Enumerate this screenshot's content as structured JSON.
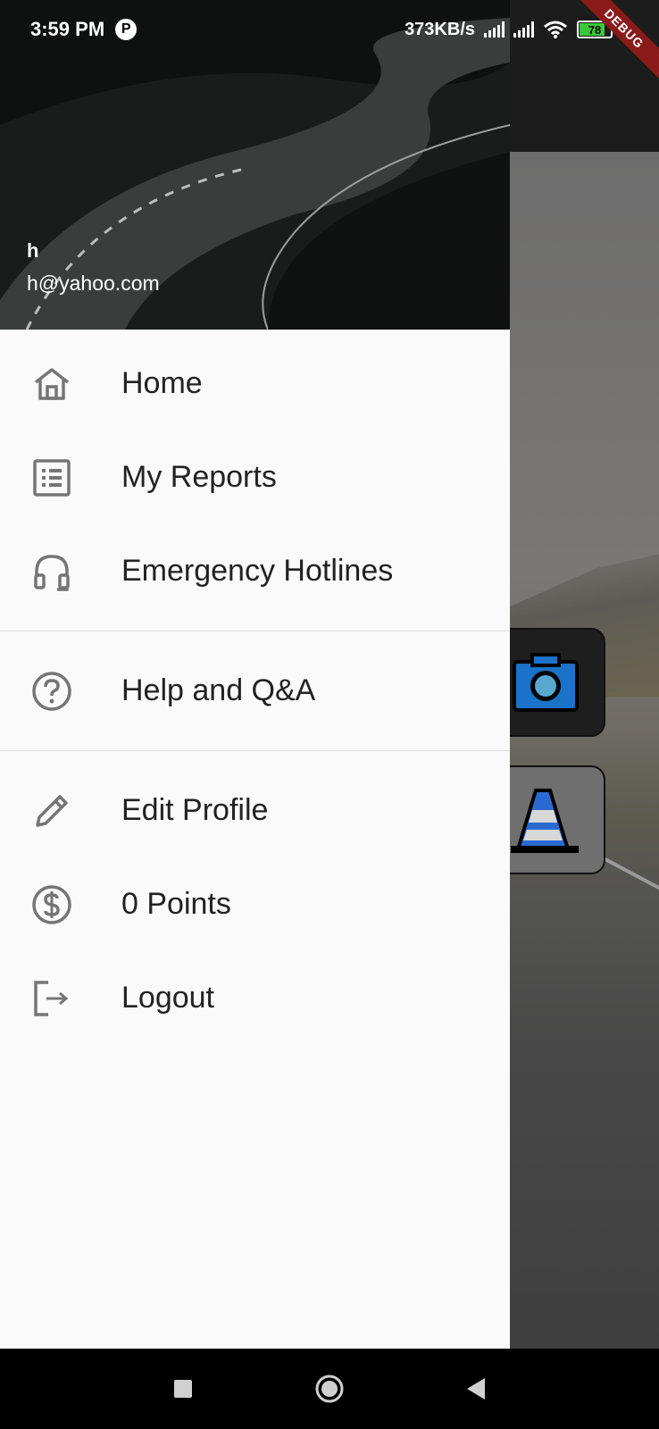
{
  "status_bar": {
    "time": "3:59 PM",
    "net_speed": "373KB/s",
    "battery_level": "78",
    "debug_label": "DEBUG"
  },
  "drawer": {
    "user": {
      "name": "h",
      "email": "h@yahoo.com"
    },
    "menu_items": [
      {
        "label": "Home",
        "icon": "home-icon"
      },
      {
        "label": "My Reports",
        "icon": "list-icon"
      },
      {
        "label": "Emergency Hotlines",
        "icon": "headset-icon"
      },
      {
        "label": "Help and Q&A",
        "icon": "help-circle-icon"
      },
      {
        "label": "Edit Profile",
        "icon": "pencil-icon"
      },
      {
        "label": "0 Points",
        "icon": "dollar-circle-icon"
      },
      {
        "label": "Logout",
        "icon": "logout-icon"
      }
    ]
  },
  "background_buttons": [
    {
      "icon": "camera-icon"
    },
    {
      "icon": "traffic-cone-icon"
    }
  ],
  "colors": {
    "drawer_bg": "#fafafa",
    "icon_gray": "#757575",
    "label_text": "#222222",
    "debug_ribbon": "#8b1a1a"
  }
}
